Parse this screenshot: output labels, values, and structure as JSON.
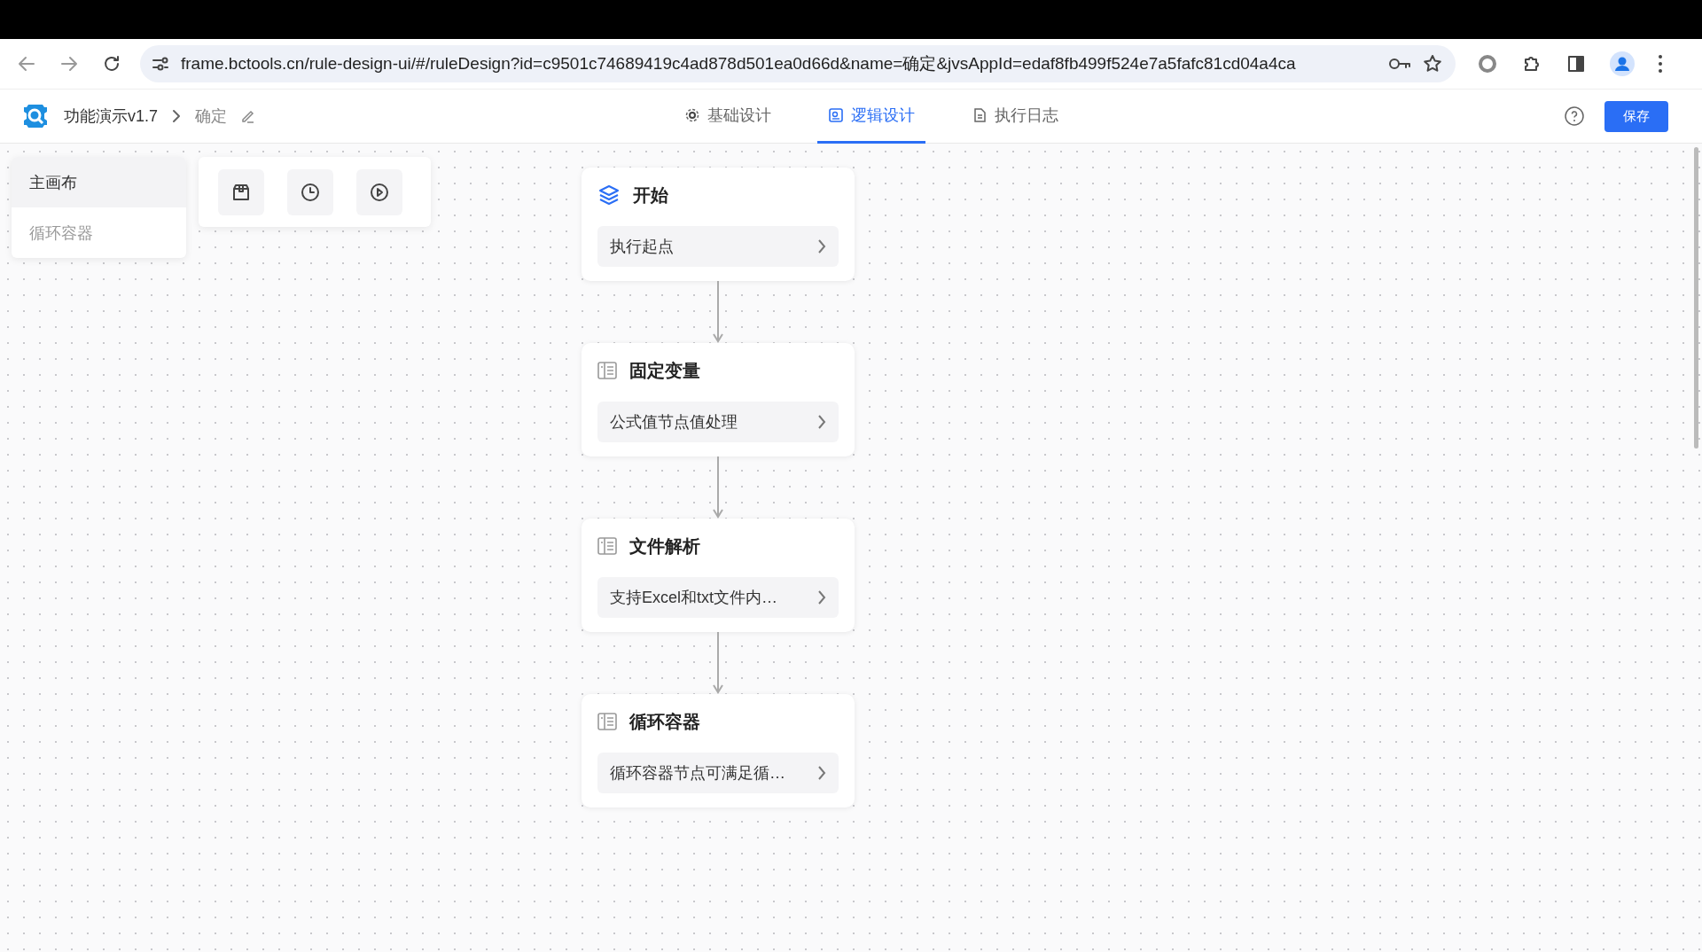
{
  "browser": {
    "url": "frame.bctools.cn/rule-design-ui/#/ruleDesign?id=c9501c74689419c4ad878d501ea0d66d&name=确定&jvsAppId=edaf8fb499f524e7a5fafc81cd04a4ca"
  },
  "header": {
    "app_title": "功能演示v1.7",
    "breadcrumb": "确定",
    "tabs": [
      {
        "label": "基础设计",
        "kind": "gear",
        "selected": false
      },
      {
        "label": "逻辑设计",
        "kind": "logic",
        "selected": true
      },
      {
        "label": "执行日志",
        "kind": "doc",
        "selected": false
      }
    ],
    "save_button": "保存"
  },
  "canvas_menu": [
    {
      "label": "主画布",
      "selected": true
    },
    {
      "label": "循环容器",
      "selected": false
    }
  ],
  "nodes": [
    {
      "title": "开始",
      "kind": "start",
      "description": "执行起点"
    },
    {
      "title": "固定变量",
      "kind": "task",
      "description": "公式值节点值处理"
    },
    {
      "title": "文件解析",
      "kind": "task",
      "description": "支持Excel和txt文件内…"
    },
    {
      "title": "循环容器",
      "kind": "task",
      "description": "循环容器节点可满足循…"
    }
  ]
}
